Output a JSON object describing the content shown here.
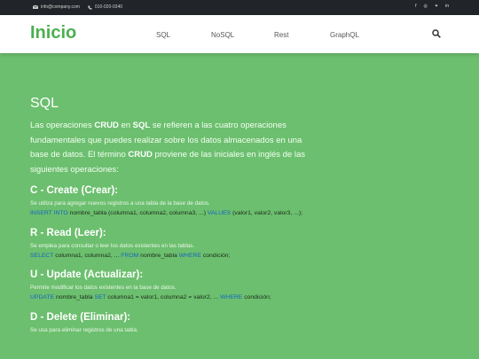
{
  "topbar": {
    "email": "info@company.com",
    "phone": "010-020-0340",
    "social": [
      "f",
      "◎",
      "✦",
      "in"
    ]
  },
  "navbar": {
    "brand": "Inicio",
    "links": [
      "SQL",
      "NoSQL",
      "Rest",
      "GraphQL"
    ]
  },
  "main": {
    "title": "SQL",
    "intro": {
      "p1": "Las operaciones ",
      "b1": "CRUD",
      "p2": " en ",
      "b2": "SQL",
      "p3": " se refieren a las cuatro operaciones fundamentales que puedes realizar sobre los datos almacenados en una base de datos. El término ",
      "b3": "CRUD",
      "p4": " proviene de las iniciales en inglés de las siguientes operaciones:"
    },
    "create": {
      "heading": "C - Create (Crear):",
      "desc": "Se utiliza para agregar nuevos registros a una tabla de la base de datos.",
      "kw1": "INSERT INTO",
      "t1": " nombre_tabla (columna1, columna2, columna3, ...) ",
      "kw2": "VALUES",
      "t2": " (valor1, valor2, valor3, ...);"
    },
    "read": {
      "heading": "R - Read (Leer):",
      "desc": "Se emplea para consultar o leer los datos existentes en las tablas.",
      "kw1": "SELECT",
      "t1": " columna1, columna2, ... ",
      "kw2": "FROM",
      "t2": " nombre_tabla ",
      "kw3": "WHERE",
      "t3": " condición;"
    },
    "update": {
      "heading": "U - Update (Actualizar):",
      "desc": "Permite modificar los datos existentes en la base de datos.",
      "kw1": "UPDATE",
      "t1": " nombre_tabla ",
      "kw2": "SET",
      "t2": " columna1 = valor1, columna2 = valor2, ... ",
      "kw3": "WHERE",
      "t3": " condición;"
    },
    "delete": {
      "heading": "D - Delete (Eliminar):",
      "desc": "Se usa para eliminar registros de una tabla."
    }
  },
  "colors": {
    "brand": "#4caf50",
    "background": "#6cbf6e",
    "keyword": "#1565c0"
  }
}
